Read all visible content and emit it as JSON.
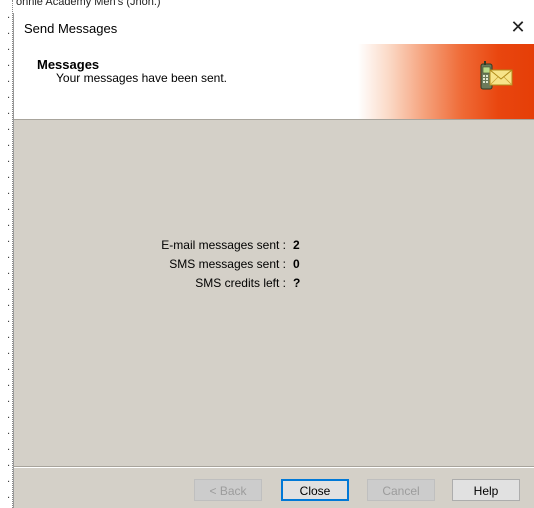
{
  "background_window": {
    "title_fragment": "onnie Academy Men's (Jnon.)"
  },
  "dialog": {
    "title": "Send Messages",
    "close_glyph": "✕"
  },
  "header": {
    "title": "Messages",
    "subtitle": "Your messages have been sent.",
    "icon": "phone-mail-icon"
  },
  "stats": [
    {
      "label": "E-mail messages sent :",
      "value": "2"
    },
    {
      "label": "SMS messages sent :",
      "value": "0"
    },
    {
      "label": "SMS credits left :",
      "value": "?"
    }
  ],
  "buttons": {
    "back": "< Back",
    "close": "Close",
    "cancel": "Cancel",
    "help": "Help"
  },
  "colors": {
    "body_bg": "#d4d0c8",
    "header_accent": "#e53e07",
    "default_button_border": "#0078d7"
  }
}
